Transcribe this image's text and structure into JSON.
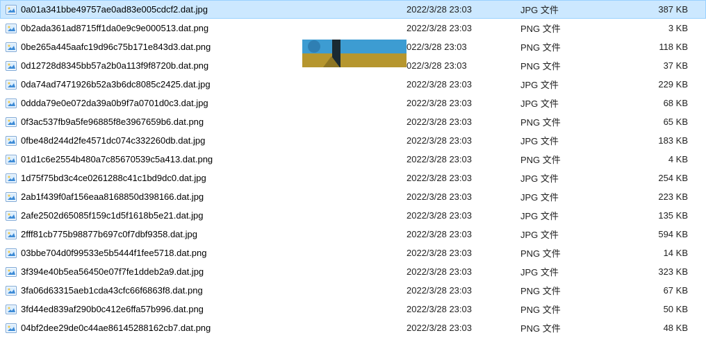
{
  "files": [
    {
      "name": "0a01a341bbe49757ae0ad83e005cdcf2.dat.jpg",
      "date": "2022/3/28 23:03",
      "type": "JPG 文件",
      "size": "387 KB",
      "kind": "jpg",
      "selected": true
    },
    {
      "name": "0b2ada361ad8715ff1da0e9c9e000513.dat.png",
      "date": "2022/3/28 23:03",
      "type": "PNG 文件",
      "size": "3 KB",
      "kind": "png",
      "selected": false
    },
    {
      "name": "0be265a445aafc19d96c75b171e843d3.dat.png",
      "date": "022/3/28 23:03",
      "type": "PNG 文件",
      "size": "118 KB",
      "kind": "png",
      "selected": false
    },
    {
      "name": "0d12728d8345bb57a2b0a113f9f8720b.dat.png",
      "date": "022/3/28 23:03",
      "type": "PNG 文件",
      "size": "37 KB",
      "kind": "png",
      "selected": false
    },
    {
      "name": "0da74ad7471926b52a3b6dc8085c2425.dat.jpg",
      "date": "2022/3/28 23:03",
      "type": "JPG 文件",
      "size": "229 KB",
      "kind": "jpg",
      "selected": false
    },
    {
      "name": "0ddda79e0e072da39a0b9f7a0701d0c3.dat.jpg",
      "date": "2022/3/28 23:03",
      "type": "JPG 文件",
      "size": "68 KB",
      "kind": "jpg",
      "selected": false
    },
    {
      "name": "0f3ac537fb9a5fe96885f8e3967659b6.dat.png",
      "date": "2022/3/28 23:03",
      "type": "PNG 文件",
      "size": "65 KB",
      "kind": "png",
      "selected": false
    },
    {
      "name": "0fbe48d244d2fe4571dc074c332260db.dat.jpg",
      "date": "2022/3/28 23:03",
      "type": "JPG 文件",
      "size": "183 KB",
      "kind": "jpg",
      "selected": false
    },
    {
      "name": "01d1c6e2554b480a7c85670539c5a413.dat.png",
      "date": "2022/3/28 23:03",
      "type": "PNG 文件",
      "size": "4 KB",
      "kind": "png",
      "selected": false
    },
    {
      "name": "1d75f75bd3c4ce0261288c41c1bd9dc0.dat.jpg",
      "date": "2022/3/28 23:03",
      "type": "JPG 文件",
      "size": "254 KB",
      "kind": "jpg",
      "selected": false
    },
    {
      "name": "2ab1f439f0af156eaa8168850d398166.dat.jpg",
      "date": "2022/3/28 23:03",
      "type": "JPG 文件",
      "size": "223 KB",
      "kind": "jpg",
      "selected": false
    },
    {
      "name": "2afe2502d65085f159c1d5f1618b5e21.dat.jpg",
      "date": "2022/3/28 23:03",
      "type": "JPG 文件",
      "size": "135 KB",
      "kind": "jpg",
      "selected": false
    },
    {
      "name": "2fff81cb775b98877b697c0f7dbf9358.dat.jpg",
      "date": "2022/3/28 23:03",
      "type": "JPG 文件",
      "size": "594 KB",
      "kind": "jpg",
      "selected": false
    },
    {
      "name": "03bbe704d0f99533e5b5444f1fee5718.dat.png",
      "date": "2022/3/28 23:03",
      "type": "PNG 文件",
      "size": "14 KB",
      "kind": "png",
      "selected": false
    },
    {
      "name": "3f394e40b5ea56450e07f7fe1ddeb2a9.dat.jpg",
      "date": "2022/3/28 23:03",
      "type": "JPG 文件",
      "size": "323 KB",
      "kind": "jpg",
      "selected": false
    },
    {
      "name": "3fa06d63315aeb1cda43cfc66f6863f8.dat.png",
      "date": "2022/3/28 23:03",
      "type": "PNG 文件",
      "size": "67 KB",
      "kind": "png",
      "selected": false
    },
    {
      "name": "3fd44ed839af290b0c412e6ffa57b996.dat.png",
      "date": "2022/3/28 23:03",
      "type": "PNG 文件",
      "size": "50 KB",
      "kind": "png",
      "selected": false
    },
    {
      "name": "04bf2dee29de0c44ae86145288162cb7.dat.png",
      "date": "2022/3/28 23:03",
      "type": "PNG 文件",
      "size": "48 KB",
      "kind": "png",
      "selected": false
    }
  ],
  "thumbnail_colors": {
    "top": "#3d9cd2",
    "bottom": "#b6962e"
  }
}
